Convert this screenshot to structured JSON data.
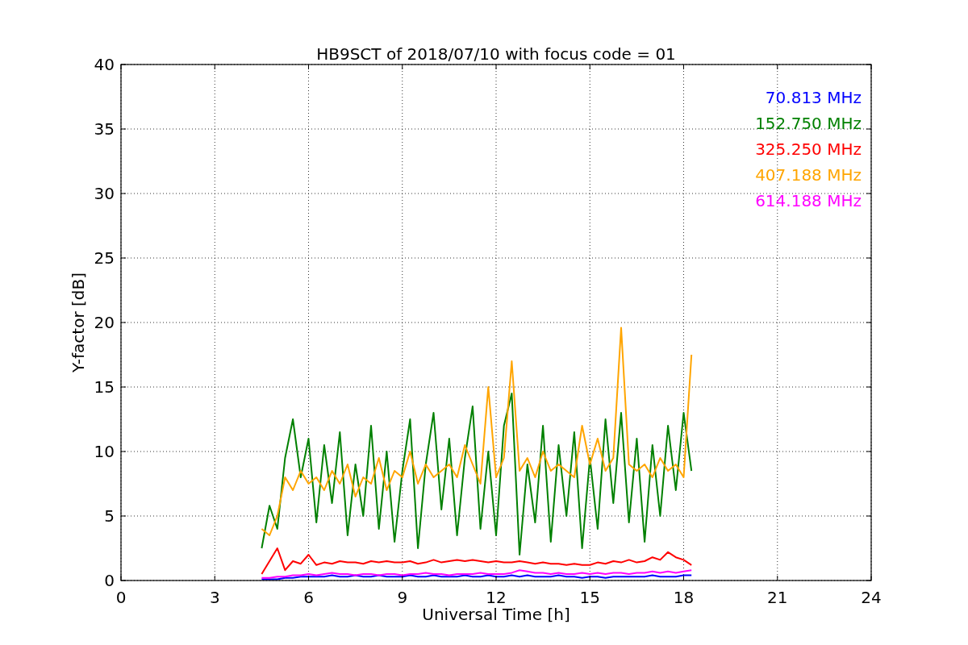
{
  "figure": {
    "chart_data": {
      "type": "line",
      "grid": true,
      "title": "HB9SCT of 2018/07/10 with focus code = 01",
      "xlabel": "Universal Time [h]",
      "ylabel": "Y-factor [dB]",
      "xlim": [
        0,
        24
      ],
      "ylim": [
        0,
        40
      ],
      "xticks": [
        0,
        3,
        6,
        9,
        12,
        15,
        18,
        21,
        24
      ],
      "yticks": [
        0,
        5,
        10,
        15,
        20,
        25,
        30,
        35,
        40
      ],
      "x": [
        4.5,
        4.75,
        5,
        5.25,
        5.5,
        5.75,
        6,
        6.25,
        6.5,
        6.75,
        7,
        7.25,
        7.5,
        7.75,
        8,
        8.25,
        8.5,
        8.75,
        9,
        9.25,
        9.5,
        9.75,
        10,
        10.25,
        10.5,
        10.75,
        11,
        11.25,
        11.5,
        11.75,
        12,
        12.25,
        12.5,
        12.75,
        13,
        13.25,
        13.5,
        13.75,
        14,
        14.25,
        14.5,
        14.75,
        15,
        15.25,
        15.5,
        15.75,
        16,
        16.25,
        16.5,
        16.75,
        17,
        17.25,
        17.5,
        17.75,
        18,
        18.25
      ],
      "series": [
        {
          "name": "70.813 MHz",
          "color": "#0000ff",
          "values": [
            0.1,
            0.1,
            0.1,
            0.2,
            0.2,
            0.3,
            0.3,
            0.3,
            0.3,
            0.4,
            0.3,
            0.3,
            0.4,
            0.3,
            0.3,
            0.4,
            0.3,
            0.3,
            0.3,
            0.4,
            0.3,
            0.3,
            0.4,
            0.3,
            0.3,
            0.3,
            0.4,
            0.3,
            0.3,
            0.4,
            0.3,
            0.3,
            0.4,
            0.3,
            0.4,
            0.3,
            0.3,
            0.3,
            0.4,
            0.3,
            0.3,
            0.2,
            0.3,
            0.3,
            0.2,
            0.3,
            0.3,
            0.3,
            0.3,
            0.3,
            0.4,
            0.3,
            0.3,
            0.3,
            0.4,
            0.4
          ]
        },
        {
          "name": "152.750 MHz",
          "color": "#008000",
          "values": [
            2.5,
            5.8,
            4.0,
            9.5,
            12.5,
            8.0,
            11.0,
            4.5,
            10.5,
            6.0,
            11.5,
            3.5,
            9.0,
            5.0,
            12.0,
            4.0,
            10.0,
            3.0,
            8.5,
            12.5,
            2.5,
            9.0,
            13.0,
            5.5,
            11.0,
            3.5,
            9.5,
            13.5,
            4.0,
            10.0,
            3.5,
            12.0,
            14.5,
            2.0,
            9.0,
            4.5,
            12.0,
            3.0,
            10.5,
            5.0,
            11.5,
            2.5,
            9.5,
            4.0,
            12.5,
            6.0,
            13.0,
            4.5,
            11.0,
            3.0,
            10.5,
            5.0,
            12.0,
            7.0,
            13.0,
            8.5
          ]
        },
        {
          "name": "325.250 MHz",
          "color": "#ff0000",
          "values": [
            0.5,
            1.5,
            2.5,
            0.8,
            1.5,
            1.3,
            2.0,
            1.2,
            1.4,
            1.3,
            1.5,
            1.4,
            1.4,
            1.3,
            1.5,
            1.4,
            1.5,
            1.4,
            1.4,
            1.5,
            1.3,
            1.4,
            1.6,
            1.4,
            1.5,
            1.6,
            1.5,
            1.6,
            1.5,
            1.4,
            1.5,
            1.4,
            1.4,
            1.5,
            1.4,
            1.3,
            1.4,
            1.3,
            1.3,
            1.2,
            1.3,
            1.2,
            1.2,
            1.4,
            1.3,
            1.5,
            1.4,
            1.6,
            1.4,
            1.5,
            1.8,
            1.6,
            2.2,
            1.8,
            1.6,
            1.2
          ]
        },
        {
          "name": "407.188 MHz",
          "color": "#ffa500",
          "values": [
            4.0,
            3.5,
            5.0,
            8.0,
            7.0,
            8.5,
            7.5,
            8.0,
            7.0,
            8.5,
            7.5,
            9.0,
            6.5,
            8.0,
            7.5,
            9.5,
            7.0,
            8.5,
            8.0,
            10.0,
            7.5,
            9.0,
            8.0,
            8.5,
            9.0,
            8.0,
            10.5,
            9.0,
            7.5,
            15.0,
            8.0,
            9.5,
            17.0,
            8.5,
            9.5,
            8.0,
            10.0,
            8.5,
            9.0,
            8.5,
            8.0,
            12.0,
            9.0,
            11.0,
            8.5,
            9.5,
            19.6,
            9.0,
            8.5,
            9.0,
            8.0,
            9.5,
            8.5,
            9.0,
            8.0,
            17.5
          ]
        },
        {
          "name": "614.188 MHz",
          "color": "#ff00ff",
          "values": [
            0.2,
            0.2,
            0.3,
            0.3,
            0.4,
            0.4,
            0.5,
            0.4,
            0.5,
            0.6,
            0.5,
            0.5,
            0.4,
            0.5,
            0.5,
            0.4,
            0.5,
            0.5,
            0.4,
            0.5,
            0.5,
            0.6,
            0.5,
            0.5,
            0.4,
            0.5,
            0.5,
            0.5,
            0.6,
            0.5,
            0.5,
            0.5,
            0.6,
            0.8,
            0.7,
            0.6,
            0.6,
            0.5,
            0.6,
            0.5,
            0.5,
            0.6,
            0.5,
            0.6,
            0.5,
            0.6,
            0.6,
            0.5,
            0.6,
            0.6,
            0.7,
            0.6,
            0.7,
            0.6,
            0.7,
            0.8
          ]
        }
      ]
    }
  }
}
